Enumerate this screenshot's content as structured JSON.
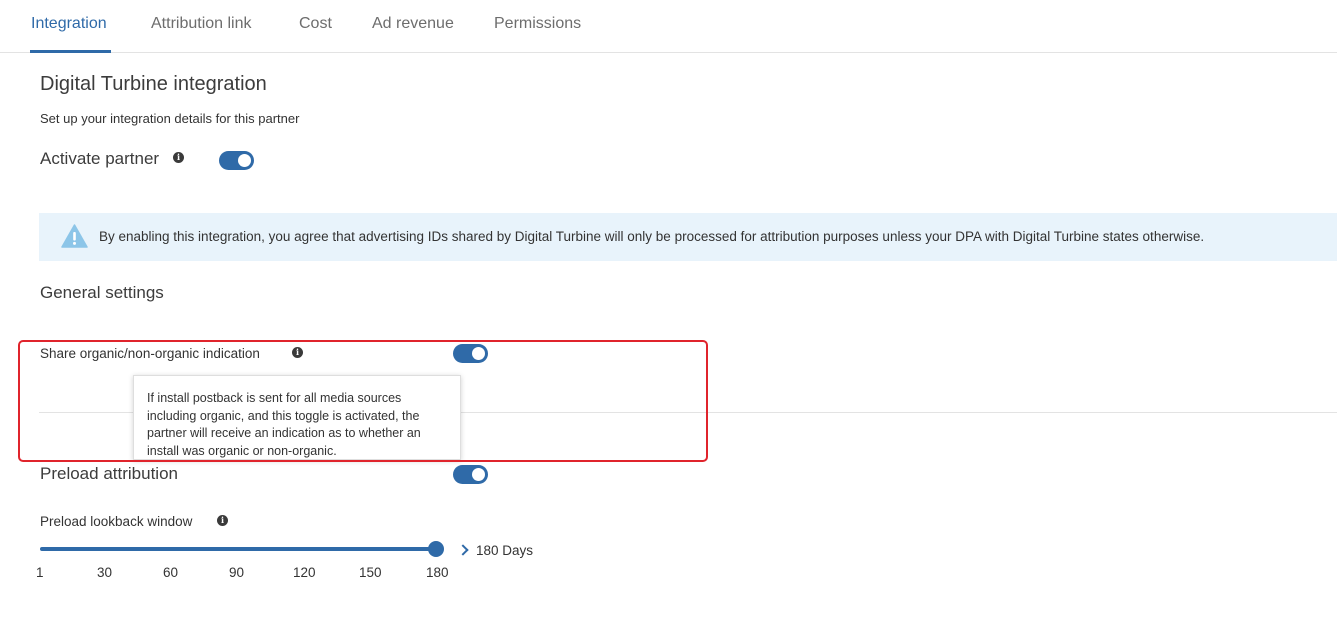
{
  "tabs": [
    {
      "label": "Integration",
      "active": true
    },
    {
      "label": "Attribution link"
    },
    {
      "label": "Cost"
    },
    {
      "label": "Ad revenue"
    },
    {
      "label": "Permissions"
    }
  ],
  "header": {
    "title": "Digital Turbine integration",
    "subtitle": "Set up your integration details for this partner"
  },
  "activate": {
    "label": "Activate partner",
    "enabled": true
  },
  "notice": {
    "text": "By enabling this integration, you agree that advertising IDs shared by Digital Turbine will only be processed for attribution purposes unless your DPA with Digital Turbine states otherwise."
  },
  "general": {
    "title": "General settings",
    "share_organic": {
      "label": "Share organic/non-organic indication",
      "enabled": true
    },
    "tooltip": "If install postback is sent for all media sources including organic, and this toggle is activated, the partner will receive an indication as to whether an install was organic or non-organic."
  },
  "preload": {
    "label": "Preload attribution",
    "enabled": true,
    "lookback_label": "Preload lookback window",
    "value_text": "180 Days",
    "ticks": [
      "1",
      "30",
      "60",
      "90",
      "120",
      "150",
      "180"
    ]
  },
  "colors": {
    "accent": "#2f6aa8",
    "highlight": "#e0242c",
    "notice_bg": "#e8f3fb"
  }
}
